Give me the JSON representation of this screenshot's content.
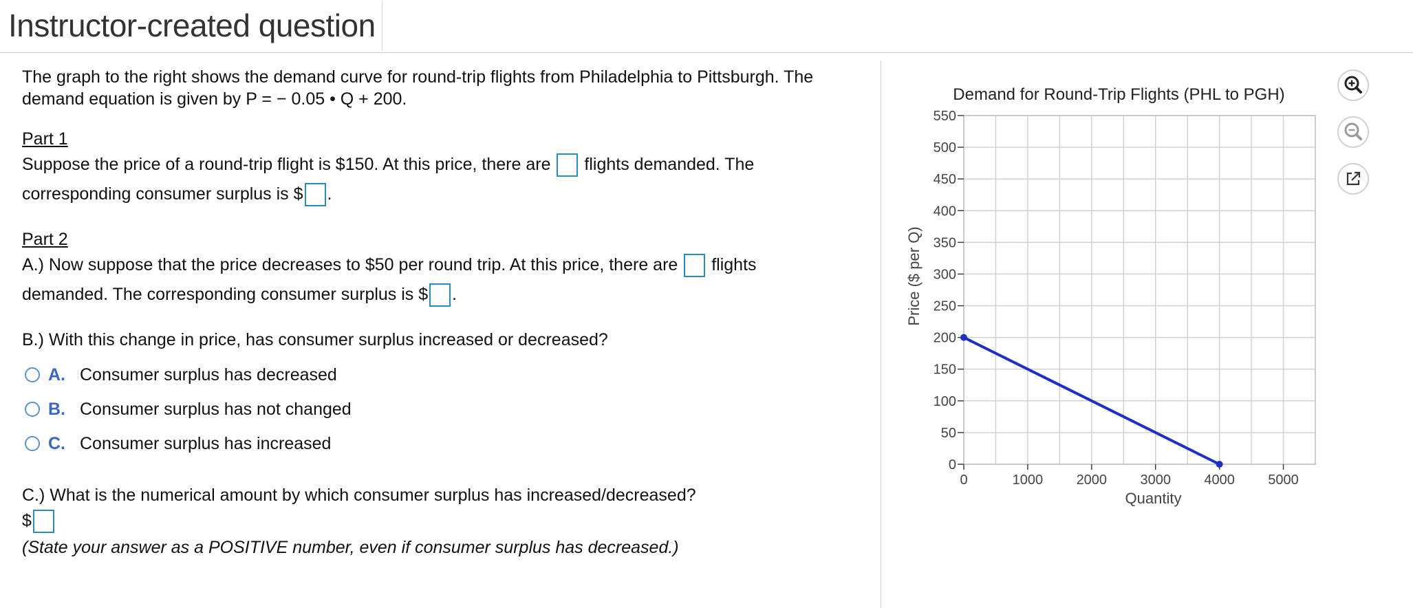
{
  "header": {
    "title": "Instructor-created question"
  },
  "question": {
    "intro_line1": "The graph to the right shows the demand curve for round-trip flights from Philadelphia to Pittsburgh. The",
    "intro_line2": "demand equation is given by P = − 0.05 • Q + 200.",
    "part1": {
      "title": "Part 1",
      "line1_before": "Suppose the price of a round-trip flight is $150. At this price, there are",
      "line1_after": "flights demanded. The",
      "line2_before": "corresponding consumer surplus is $",
      "line2_after": "."
    },
    "part2": {
      "title": "Part 2",
      "a_line1_before": "A.) Now suppose that the price decreases to $50 per round trip. At this price, there are",
      "a_line1_after": "flights",
      "a_line2_before": "demanded. The corresponding consumer surplus is $",
      "a_line2_after": ".",
      "b_prompt": "B.) With this change in price, has consumer surplus increased or decreased?",
      "options": [
        {
          "letter": "A.",
          "text": "Consumer surplus has decreased"
        },
        {
          "letter": "B.",
          "text": "Consumer surplus has not changed"
        },
        {
          "letter": "C.",
          "text": "Consumer surplus has increased"
        }
      ],
      "c_prompt": "C.) What is the numerical amount by which consumer surplus has increased/decreased?",
      "c_dollar": "$",
      "c_note": "(State your answer as a POSITIVE number, even if consumer surplus has decreased.)"
    }
  },
  "tools": {
    "zoom_in": "zoom-in-icon",
    "zoom_out": "zoom-out-icon",
    "popout": "popout-icon"
  },
  "chart_data": {
    "type": "line",
    "title": "Demand for Round-Trip Flights (PHL to PGH)",
    "xlabel": "Quantity",
    "ylabel": "Price ($ per Q)",
    "xlim": [
      0,
      5500
    ],
    "ylim": [
      0,
      550
    ],
    "x_ticks": [
      0,
      1000,
      2000,
      3000,
      4000,
      5000
    ],
    "y_ticks": [
      0,
      50,
      100,
      150,
      200,
      250,
      300,
      350,
      400,
      450,
      500,
      550
    ],
    "x_grid_step": 500,
    "grid": true,
    "series": [
      {
        "points": [
          [
            0,
            200
          ],
          [
            4000,
            0
          ]
        ],
        "color": "#1f2fc4"
      }
    ]
  }
}
